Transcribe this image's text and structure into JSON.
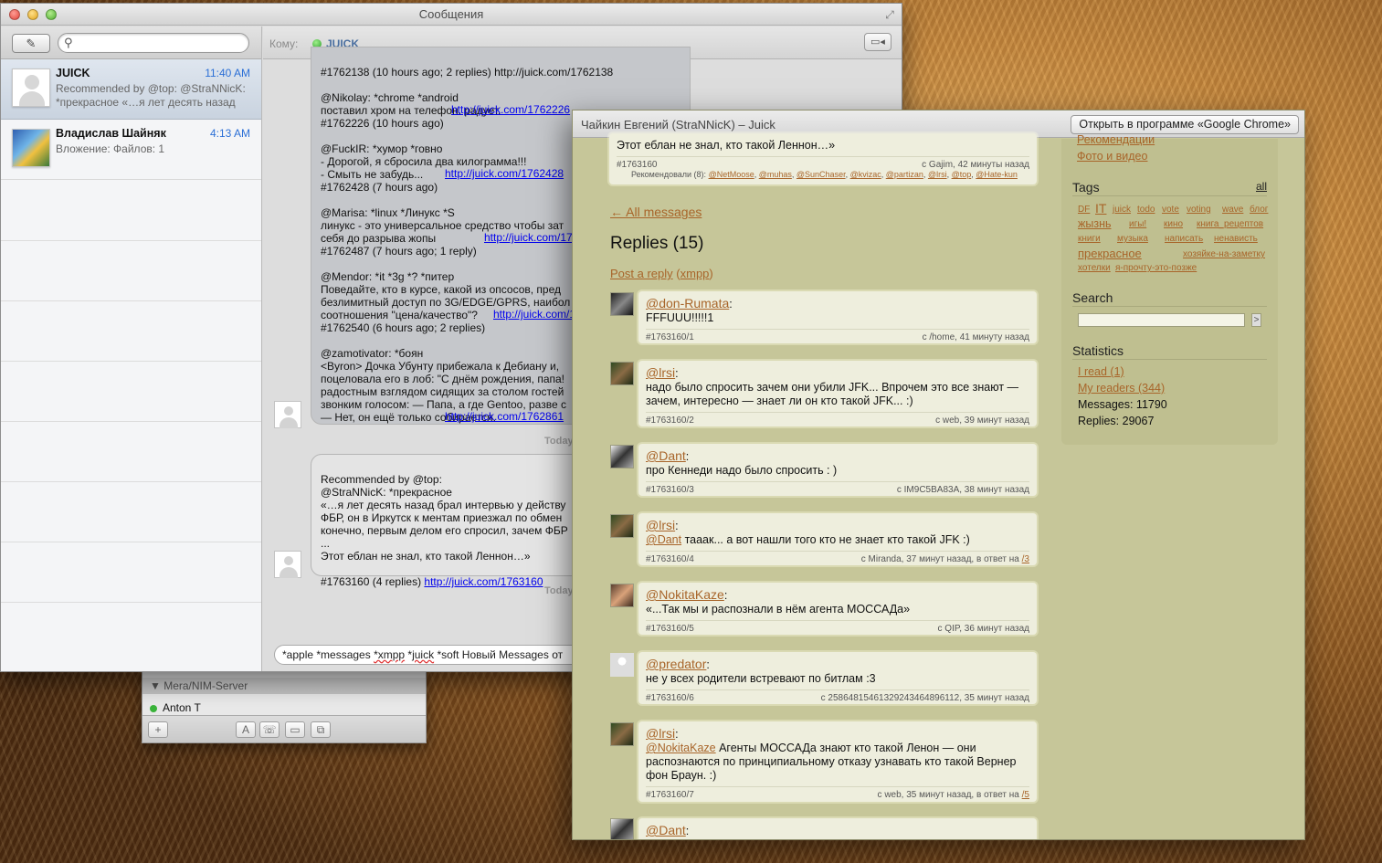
{
  "messages_window": {
    "title": "Сообщения",
    "search_placeholder": "",
    "conversations": [
      {
        "name": "JUICK",
        "time": "11:40 AM",
        "preview": "Recommended by @top: @StraNNicK: *прекрасное «…я лет десять назад"
      },
      {
        "name": "Владислав Шайняк",
        "time": "4:13 AM",
        "preview": "Вложение: Файлов: 1"
      }
    ],
    "to_label": "Кому:",
    "to_name": "JUICK",
    "bubble1": "#1762138 (10 hours ago; 2 replies) http://juick.com/1762138\n\n@Nikolay: *chrome *android\nпоставил хром на телефон. радует.\n#1762226 (10 hours ago) \n\n@FuckIR: *хумор *говно\n- Дорогой, я сбросила два килограмма!!!\n- Смыть не забудь...\n#1762428 (7 hours ago) \n\n@Marisa: *linux *Линукс *S\nлинукс - это универсальное средство чтобы зат\nсебя до разрыва жопы\n#1762487 (7 hours ago; 1 reply) \n\n@Mendor: *it *3g *? *питер\nПоведайте, кто в курсе, какой из опсосов, пред\nбезлимитный доступ по 3G/EDGE/GPRS, наибол\nсоотношения \"цена/качество\"?\n#1762540 (6 hours ago; 2 replies) \n\n@zamotivator: *боян\n<Byron> Дочка Убунту прибежала к Дебиану и,\nпоцеловала его в лоб: \"С днём рождения, папа!\nрадостным взглядом сидящих за столом гостей\nзвонким голосом: — Папа, а где Gentoo, разве с\n— Нет, он ещё только собирается.\n#1762861 (2 hours ago) ",
    "links1": [
      "http://juick.com/1762226",
      "http://juick.com/1762428",
      "http://juick.com/17",
      "http://juick.com/1",
      "http://juick.com/1762861"
    ],
    "today1": "Today",
    "bubble2": "Recommended by @top:\n@StraNNicK: *прекрасное\n«…я лет десять назад брал интервью у действу\nФБР, он в Иркутск к ментам приезжал по обмен\nконечно, первым делом его спросил, зачем ФБР\n...\nЭтот еблан не знал, кто такой Леннон…»\n\n#1763160 (4 replies) ",
    "link2": "http://juick.com/1763160",
    "today2": "Today",
    "input_text_a": "*apple *messages ",
    "input_text_b": "*xmpp",
    "input_text_c": " *",
    "input_text_d": "juick",
    "input_text_e": " *soft Новый Messages от"
  },
  "buddy_window": {
    "group": "Mera/NIM-Server",
    "contact": "Anton T"
  },
  "juick_window": {
    "title": "Чайкин Евгений (StraNNicK) – Juick",
    "open_button": "Открыть в программе «Google Chrome»",
    "post_tail": "Этот еблан не знал, кто такой Леннон…»",
    "post_id": "#1763160",
    "post_src": "с Gajim, 42 минуты назад",
    "recommended_label": "Рекомендовали (8):",
    "recommended": [
      "@NetMoose",
      "@muhas",
      "@SunChaser",
      "@kvizac",
      "@partizan",
      "@lrsi",
      "@top",
      "@Hate-kun"
    ],
    "all_messages": "← All messages",
    "replies_heading": "Replies (15)",
    "post_reply": "Post a reply",
    "xmpp": "xmpp",
    "replies": [
      {
        "author": "@don-Rumata",
        "text": "FFFUUU!!!!!1",
        "id": "#1763160/1",
        "src": "с /home, 41 минуту назад"
      },
      {
        "author": "@lrsi",
        "text": "надо было спросить зачем они убили JFK... Впрочем это все знают — зачем, интересно — знает ли он кто такой JFK... :)",
        "id": "#1763160/2",
        "src": "с web, 39 минут назад"
      },
      {
        "author": "@Dant",
        "text": "про Кеннеди надо было спросить : )",
        "id": "#1763160/3",
        "src": "с IM9C5BA83A, 38 минут назад"
      },
      {
        "author": "@lrsi",
        "mention": "@Dant",
        "text": " тааак... а вот нашли того кто не знает кто такой JFK :)",
        "id": "#1763160/4",
        "src": "с Miranda, 37 минут назад, в ответ на ",
        "reply_to": "/3"
      },
      {
        "author": "@NokitaKaze",
        "text": "«...Так мы и распознали в нём агента МОССАДа»",
        "id": "#1763160/5",
        "src": "с QIP, 36 минут назад"
      },
      {
        "author": "@predator",
        "text": "не у всех родители встревают по битлам :3",
        "id": "#1763160/6",
        "src": "с 25864815461329243464896112, 35 минут назад"
      },
      {
        "author": "@lrsi",
        "mention": "@NokitaKaze",
        "text": " Агенты МОССАДа знают кто такой Ленон — они распознаются по принципиальному отказу узнавать кто такой Вернер фон Браун. :)",
        "id": "#1763160/7",
        "src": "с web, 35 минут назад, в ответ на ",
        "reply_to": "/5"
      },
      {
        "author": "@Dant"
      }
    ],
    "sidebar": {
      "link1": "Рекомендации",
      "link2": "Фото и видео",
      "tags_heading": "Tags",
      "tags_all": "all",
      "tags": [
        "DF",
        "IT",
        "juick",
        "todo",
        "vote",
        "voting",
        "wave",
        "блог",
        "жызнь",
        "игы!",
        "кино",
        "книга_рецептов",
        "книги",
        "музыка",
        "написать",
        "ненависть",
        "прекрасное",
        "хозяйке-на-заметку",
        "хотелки",
        "я-прочту-это-позже"
      ],
      "search_heading": "Search",
      "search_go": ">",
      "stats_heading": "Statistics",
      "read": "I read (1)",
      "readers": "My readers (344)",
      "messages": "Messages: 11790",
      "replies": "Replies: 29067"
    }
  }
}
